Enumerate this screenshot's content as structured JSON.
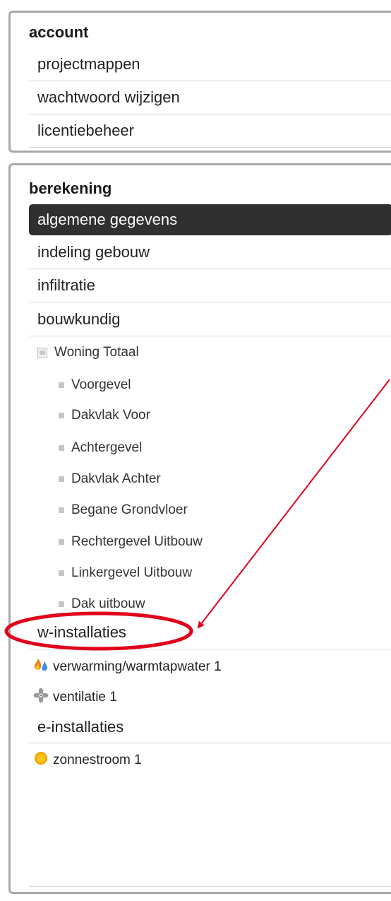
{
  "account": {
    "title": "account",
    "items": [
      "projectmappen",
      "wachtwoord wijzigen",
      "licentiebeheer"
    ]
  },
  "berekening": {
    "title": "berekening",
    "items": [
      "algemene gegevens",
      "indeling gebouw",
      "infiltratie",
      "bouwkundig"
    ],
    "active_item": "algemene gegevens",
    "tree_root": "Woning Totaal",
    "tree_children": [
      "Voorgevel",
      "Dakvlak Voor",
      "Achtergevel",
      "Dakvlak Achter",
      "Begane Grondvloer",
      "Rechtergevel Uitbouw",
      "Linkergevel Uitbouw",
      "Dak uitbouw"
    ],
    "w_installaties": {
      "label": "w-installaties",
      "items": [
        {
          "label": "verwarming/warmtapwater 1",
          "icon": "flame-drop-icon"
        },
        {
          "label": "ventilatie 1",
          "icon": "fan-icon"
        }
      ]
    },
    "e_installaties": {
      "label": "e-installaties",
      "items": [
        {
          "label": "zonnestroom 1",
          "icon": "sun-icon"
        }
      ]
    }
  },
  "colors": {
    "active_bg": "#303030",
    "annotation": "#e0001b",
    "panel_border": "#a8a8a8"
  }
}
